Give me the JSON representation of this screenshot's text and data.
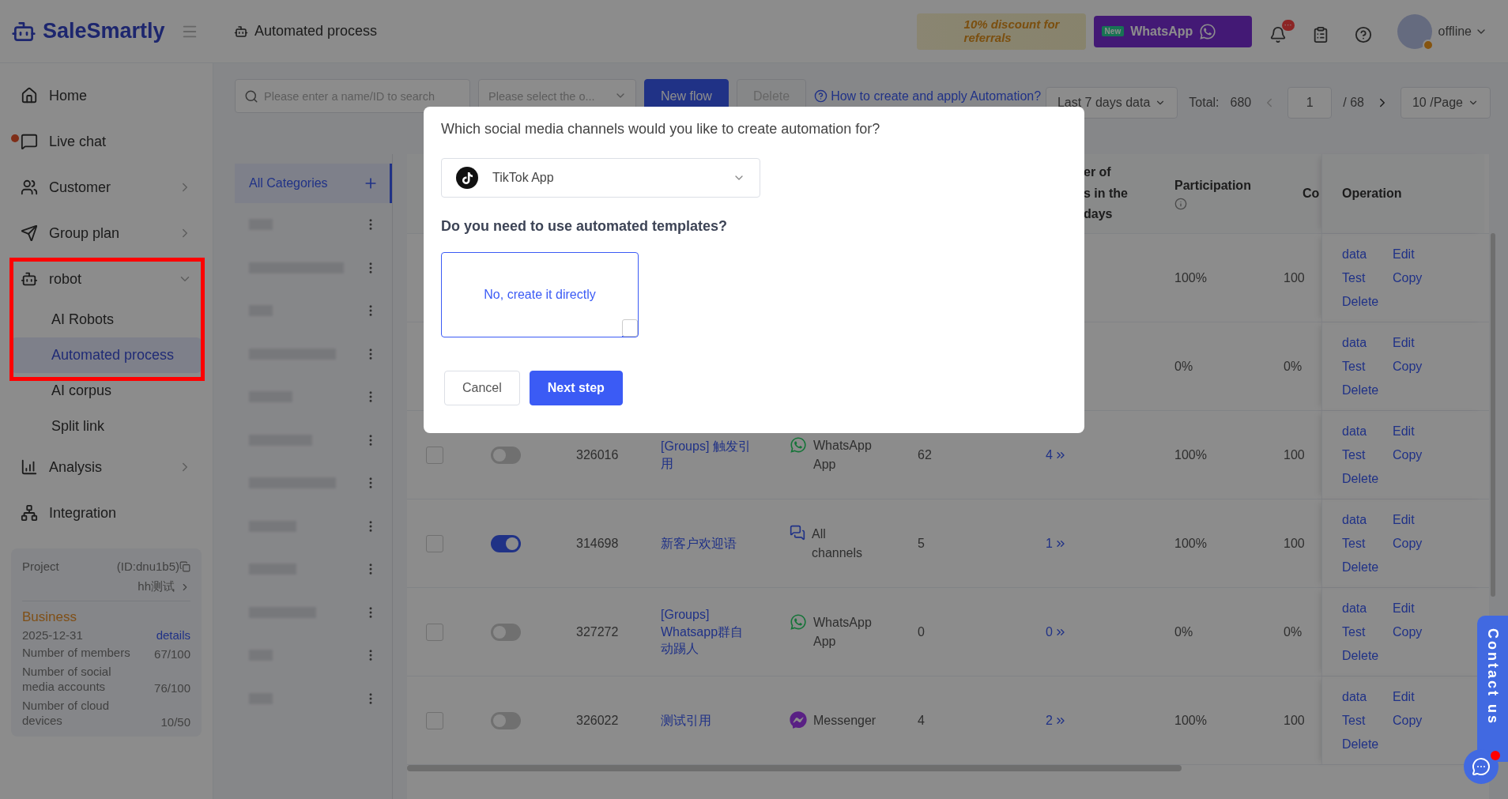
{
  "header": {
    "logo": "SaleSmartly",
    "page_title": "Automated process",
    "promo": "10% discount for referrals",
    "whatsapp_banner": {
      "badge": "New",
      "label": "WhatsApp"
    },
    "notification_badge": "···",
    "status": "offline"
  },
  "sidebar": {
    "items": [
      {
        "label": "Home",
        "has_submenu": false,
        "unread": false,
        "highlighted": false
      },
      {
        "label": "Live chat",
        "has_submenu": false,
        "unread": true,
        "highlighted": false
      },
      {
        "label": "Customer",
        "has_submenu": true,
        "expanded": false,
        "unread": false,
        "highlighted": false
      },
      {
        "label": "Group plan",
        "has_submenu": true,
        "expanded": false,
        "unread": false,
        "highlighted": false
      },
      {
        "label": "robot",
        "has_submenu": true,
        "expanded": true,
        "unread": false,
        "highlighted": true,
        "children": [
          {
            "label": "AI Robots",
            "selected": false
          },
          {
            "label": "Automated process",
            "selected": true
          },
          {
            "label": "AI corpus",
            "selected": false
          },
          {
            "label": "Split link",
            "selected": false
          }
        ]
      },
      {
        "label": "Analysis",
        "has_submenu": true,
        "expanded": false,
        "unread": false,
        "highlighted": false
      },
      {
        "label": "Integration",
        "has_submenu": false,
        "unread": false,
        "highlighted": false
      }
    ],
    "project": {
      "label": "Project",
      "id": "(ID:dnu1b5)",
      "name": "hh测试",
      "plan": "Business",
      "expiry": "2025-12-31",
      "details_link": "details",
      "quotas": [
        {
          "label": "Number of members",
          "value": "67/100"
        },
        {
          "label": "Number of social media accounts",
          "value": "76/100"
        },
        {
          "label": "Number of cloud devices",
          "value": "10/50"
        }
      ]
    }
  },
  "toolbar": {
    "search_placeholder": "Please enter a name/ID to search",
    "category_placeholder": "Please select the o...",
    "new_button": "New flow",
    "delete_button": {
      "label": "Delete",
      "disabled": true
    },
    "help_link": "How to create and apply Automation?",
    "range_select": "Last 7 days data",
    "total_label": "Total:",
    "total": "680",
    "page_input": "1",
    "page_count": "/ 68",
    "page_size": "10 /Page"
  },
  "categories": [
    {
      "label": "All Categories",
      "selected": true
    }
  ],
  "table": {
    "columns": [
      {
        "lines": [
          "er of",
          "s in the",
          "days"
        ],
        "info": false
      },
      {
        "lines": [
          "Participation"
        ],
        "info": true
      },
      {
        "lines": [
          "Co"
        ],
        "info": false
      },
      {
        "lines": [
          "Operation"
        ],
        "info": false
      }
    ],
    "rows": [
      {
        "participation": "100%",
        "column_9": "100",
        "actions": [
          "data",
          "Edit",
          "Test",
          "Copy",
          "Delete"
        ]
      },
      {
        "participation": "0%",
        "column_9": "0%",
        "actions": [
          "data",
          "Edit",
          "Test",
          "Copy",
          "Delete"
        ]
      },
      {
        "checked": false,
        "on": false,
        "id": "326016",
        "name": "[Groups] 触发引用",
        "channel": {
          "kind": "whatsapp",
          "label": "WhatsApp App"
        },
        "users": "62",
        "count": "4",
        "participation": "100%",
        "column_9": "100",
        "actions": [
          "data",
          "Edit",
          "Test",
          "Copy",
          "Delete"
        ]
      },
      {
        "checked": false,
        "on": true,
        "id": "314698",
        "name": "新客户欢迎语",
        "channel": {
          "kind": "all",
          "label": "All channels"
        },
        "users": "5",
        "count": "1",
        "participation": "100%",
        "column_9": "100",
        "actions": [
          "data",
          "Edit",
          "Test",
          "Copy",
          "Delete"
        ]
      },
      {
        "checked": false,
        "on": false,
        "id": "327272",
        "name": "[Groups] Whatsapp群自动踢人",
        "channel": {
          "kind": "whatsapp",
          "label": "WhatsApp App"
        },
        "users": "0",
        "count": "0",
        "participation": "0%",
        "column_9": "0%",
        "actions": [
          "data",
          "Edit",
          "Test",
          "Copy",
          "Delete"
        ]
      },
      {
        "checked": false,
        "on": false,
        "id": "326022",
        "name": "测试引用",
        "channel": {
          "kind": "messenger",
          "label": "Messenger"
        },
        "users": "4",
        "count": "2",
        "participation": "100%",
        "column_9": "100",
        "actions": [
          "data",
          "Edit",
          "Test",
          "Copy",
          "Delete"
        ]
      }
    ]
  },
  "modal": {
    "question": "Which social media channels would you like to create automation for?",
    "channel_select": {
      "kind": "tiktok",
      "label": "TikTok App"
    },
    "template_question": "Do you need to use automated templates?",
    "options": [
      {
        "label": "No, create it directly",
        "selected": true
      }
    ],
    "cancel": "Cancel",
    "next": "Next step"
  },
  "contact_tab": {
    "label": "Contact us",
    "unread": true
  }
}
